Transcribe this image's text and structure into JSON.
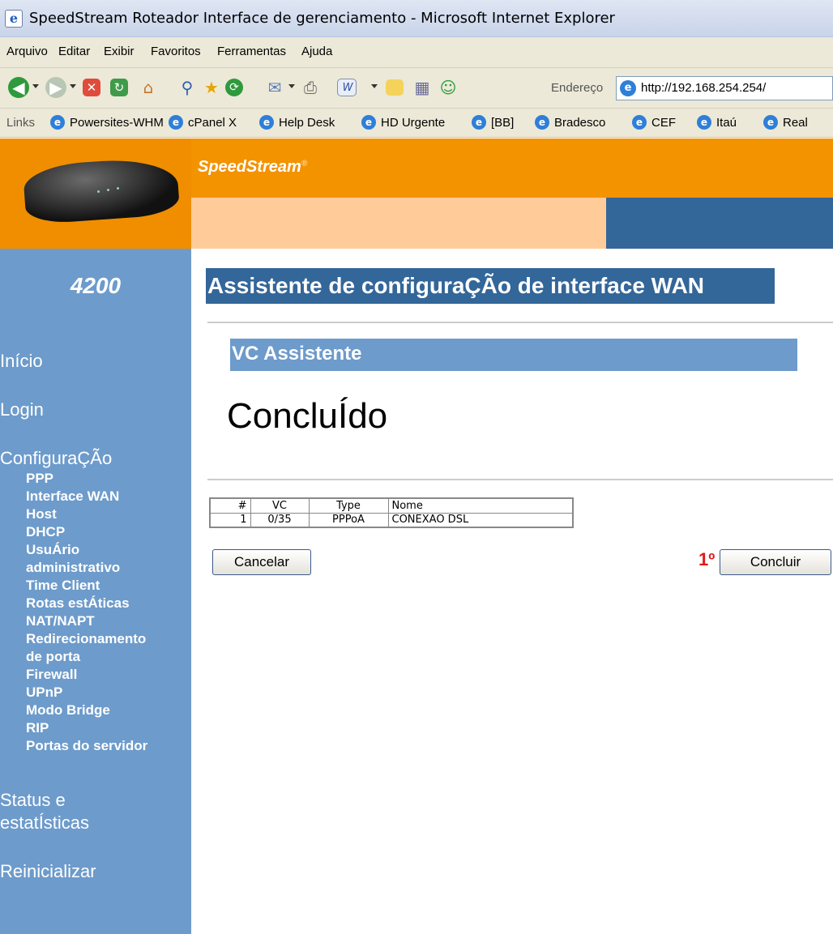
{
  "window": {
    "title": "SpeedStream Roteador Interface de gerenciamento - Microsoft Internet Explorer"
  },
  "menu": [
    "Arquivo",
    "Editar",
    "Exibir",
    "Favoritos",
    "Ferramentas",
    "Ajuda"
  ],
  "toolbar": {
    "address_label": "Endereço",
    "address_url": "http://192.168.254.254/",
    "icons": [
      "back-icon",
      "forward-icon",
      "stop-icon",
      "refresh-icon",
      "home-icon",
      "search-icon",
      "favorites-icon",
      "history-icon",
      "mail-icon",
      "print-icon",
      "word-icon",
      "folder-icon",
      "research-icon",
      "messenger-icon"
    ]
  },
  "links": {
    "label": "Links",
    "items": [
      "Powersites-WHM",
      "cPanel X",
      "Help Desk",
      "HD Urgente",
      "[BB]",
      "Bradesco",
      "CEF",
      "Itaú",
      "Real"
    ]
  },
  "header": {
    "brand": "SpeedStream",
    "model": "4200"
  },
  "sidebar": {
    "inicio": "Início",
    "login": "Login",
    "configuracao": "ConfiguraÇÃo",
    "config_items": [
      "PPP",
      "Interface WAN",
      "Host",
      "DHCP",
      "UsuÁrio",
      "administrativo",
      "Time Client",
      "Rotas estÁticas",
      "NAT/NAPT",
      "Redirecionamento",
      "de porta",
      "Firewall",
      "UPnP",
      "Modo Bridge",
      "RIP",
      "Portas do servidor"
    ],
    "status_line1": "Status e",
    "status_line2": "estatÍsticas",
    "reinicializar": "Reinicializar"
  },
  "main": {
    "wizard_title": "Assistente de configuraÇÃo de interface WAN",
    "vc_title": "VC Assistente",
    "done_text": "ConcluÍdo",
    "table": {
      "headers": [
        "#",
        "VC",
        "Type",
        "Nome"
      ],
      "rows": [
        [
          "1",
          "0/35",
          "PPPoA",
          "CONEXAO DSL"
        ]
      ]
    },
    "cancel_label": "Cancelar",
    "step_marker": "1º",
    "finish_label": "Concluir"
  },
  "colors": {
    "orange": "#f39300",
    "peach": "#ffcc99",
    "navy": "#336699",
    "sidebar_blue": "#6d9bcb",
    "marker_red": "#e01b1b"
  }
}
